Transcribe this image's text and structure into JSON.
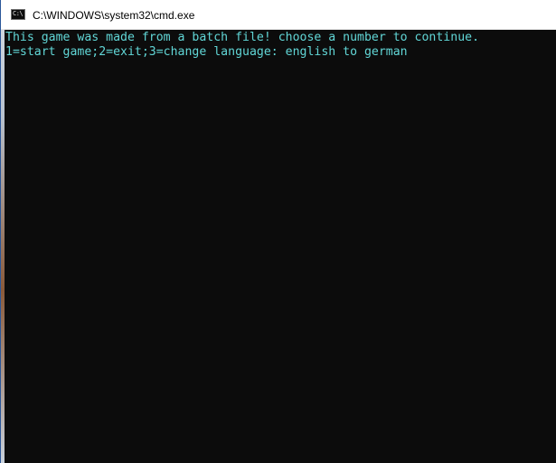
{
  "window": {
    "title": "C:\\WINDOWS\\system32\\cmd.exe",
    "app_icon": "cmd-icon",
    "app_icon_glyph": "C:\\"
  },
  "console": {
    "text_color": "#61d6d6",
    "background_color": "#0c0c0c",
    "lines": [
      "This game was made from a batch file! choose a number to continue.",
      "1=start game;2=exit;3=change language: english to german"
    ]
  }
}
